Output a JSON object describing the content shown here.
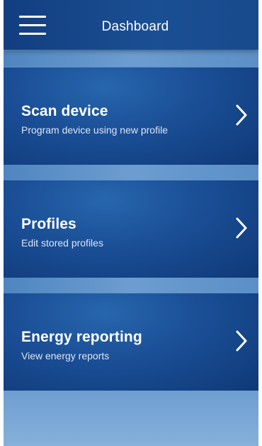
{
  "header": {
    "title": "Dashboard",
    "menu_icon": "hamburger-menu-icon"
  },
  "cards": [
    {
      "title": "Scan device",
      "subtitle": "Program device using new profile",
      "icon": "chevron-right-icon"
    },
    {
      "title": "Profiles",
      "subtitle": "Edit stored profiles",
      "icon": "chevron-right-icon"
    },
    {
      "title": "Energy reporting",
      "subtitle": "View energy reports",
      "icon": "chevron-right-icon"
    }
  ],
  "colors": {
    "header": "#184a8d",
    "card": "#1a4e95",
    "stripe": "#6d9dd0",
    "text": "#ffffff"
  }
}
